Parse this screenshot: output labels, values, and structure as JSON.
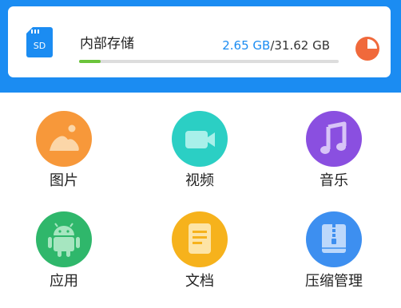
{
  "storage": {
    "title": "内部存储",
    "used": "2.65 GB",
    "separator": "/",
    "total": "31.62 GB",
    "used_fraction": 0.084,
    "sd_label": "SD",
    "colors": {
      "used": "#1b8cf2",
      "progress": "#6bc43b",
      "pie": "#f0693b",
      "header_bg": "#1b8cf2"
    }
  },
  "categories": [
    {
      "label": "图片",
      "icon": "image-icon",
      "color": "#f7983a"
    },
    {
      "label": "视频",
      "icon": "video-icon",
      "color": "#2bcfc4"
    },
    {
      "label": "音乐",
      "icon": "music-icon",
      "color": "#8a4fe0"
    },
    {
      "label": "应用",
      "icon": "android-icon",
      "color": "#2fb76b"
    },
    {
      "label": "文档",
      "icon": "document-icon",
      "color": "#f6b21c"
    },
    {
      "label": "压缩管理",
      "icon": "zip-icon",
      "color": "#3d8ff0"
    }
  ]
}
